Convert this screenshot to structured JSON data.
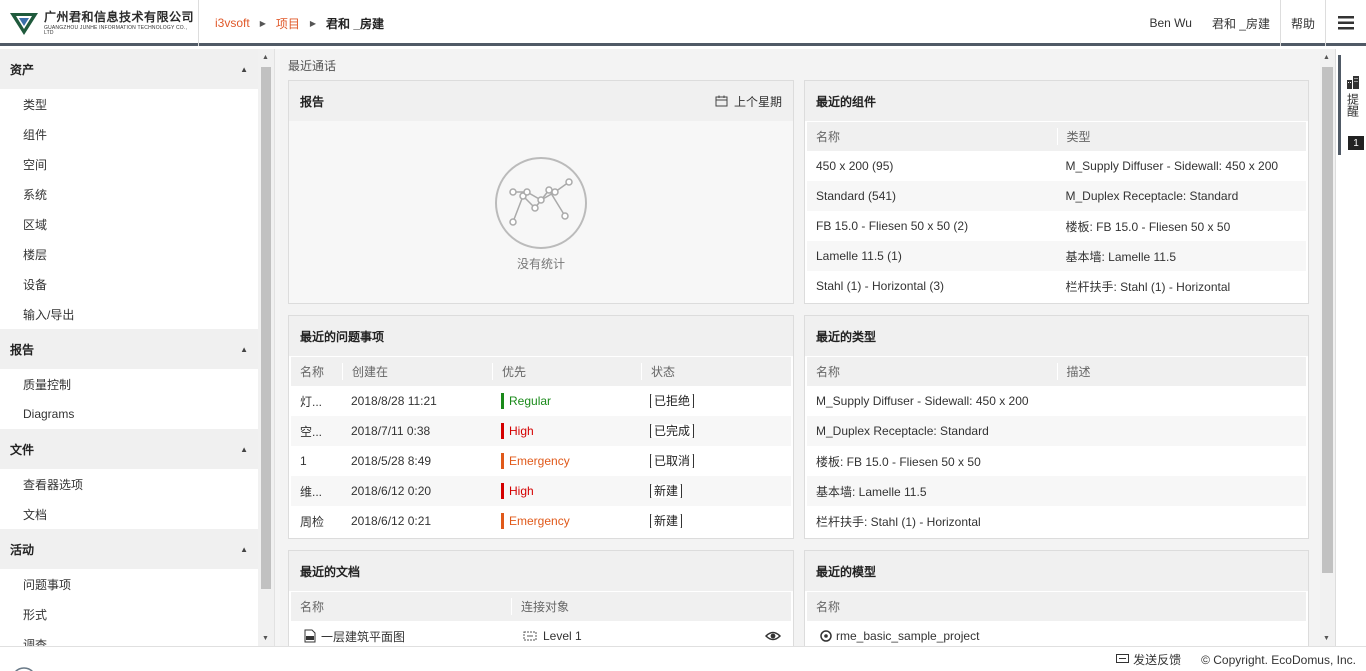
{
  "header": {
    "logo_cn": "广州君和信息技术有限公司",
    "logo_en": "GUANGZHOU JUNHE INFORMATION TECHNOLOGY CO., LTD",
    "breadcrumbs": [
      "i3vsoft",
      "项目",
      "君和 _房建"
    ],
    "user": "Ben Wu",
    "project": "君和 _房建",
    "help": "帮助"
  },
  "sidebar": {
    "sections": [
      {
        "title": "资产",
        "items": [
          "类型",
          "组件",
          "空间",
          "系统",
          "区域",
          "楼层",
          "设备",
          "输入/导出"
        ]
      },
      {
        "title": "报告",
        "items": [
          "质量控制",
          "Diagrams"
        ]
      },
      {
        "title": "文件",
        "items": [
          "查看器选项",
          "文档"
        ]
      },
      {
        "title": "活动",
        "items": [
          "问题事项",
          "形式",
          "调查"
        ]
      }
    ]
  },
  "main": {
    "title": "最近通话",
    "report": {
      "title": "报告",
      "period": "上个星期",
      "empty": "没有统计"
    },
    "components": {
      "title": "最近的组件",
      "headers": [
        "名称",
        "类型"
      ],
      "rows": [
        [
          "450 x 200 (95)",
          "M_Supply Diffuser - Sidewall: 450 x 200"
        ],
        [
          "Standard (541)",
          "M_Duplex Receptacle: Standard"
        ],
        [
          "FB 15.0 - Fliesen 50 x 50 (2)",
          "楼板: FB 15.0 - Fliesen 50 x 50"
        ],
        [
          "Lamelle 11.5 (1)",
          "基本墙: Lamelle 11.5"
        ],
        [
          "Stahl (1) - Horizontal (3)",
          "栏杆扶手: Stahl (1) - Horizontal"
        ]
      ]
    },
    "issues": {
      "title": "最近的问题事项",
      "headers": [
        "名称",
        "创建在",
        "优先",
        "状态"
      ],
      "rows": [
        {
          "name": "灯...",
          "date": "2018/8/28 11:21",
          "priority": "Regular",
          "color": "#1a8a1a",
          "status": "已拒绝"
        },
        {
          "name": "空...",
          "date": "2018/7/11 0:38",
          "priority": "High",
          "color": "#d40000",
          "status": "已完成"
        },
        {
          "name": "1",
          "date": "2018/5/28 8:49",
          "priority": "Emergency",
          "color": "#e0591a",
          "status": "已取消"
        },
        {
          "name": "维...",
          "date": "2018/6/12 0:20",
          "priority": "High",
          "color": "#d40000",
          "status": "新建"
        },
        {
          "name": "周检",
          "date": "2018/6/12 0:21",
          "priority": "Emergency",
          "color": "#e0591a",
          "status": "新建"
        }
      ]
    },
    "types": {
      "title": "最近的类型",
      "headers": [
        "名称",
        "描述"
      ],
      "rows": [
        [
          "M_Supply Diffuser - Sidewall: 450 x 200",
          ""
        ],
        [
          "M_Duplex Receptacle: Standard",
          ""
        ],
        [
          "楼板: FB 15.0 - Fliesen 50 x 50",
          ""
        ],
        [
          "基本墙: Lamelle 11.5",
          ""
        ],
        [
          "栏杆扶手: Stahl (1) - Horizontal",
          ""
        ]
      ]
    },
    "documents": {
      "title": "最近的文档",
      "headers": [
        "名称",
        "连接对象",
        ""
      ],
      "rows": [
        {
          "name": "一层建筑平面图",
          "link": "Level 1"
        }
      ]
    },
    "models": {
      "title": "最近的模型",
      "headers": [
        "名称"
      ],
      "rows": [
        "rme_basic_sample_project"
      ]
    }
  },
  "right_strip": {
    "label": "提醒",
    "badge": "1"
  },
  "footer": {
    "feedback": "发送反馈",
    "copyright": "© Copyright. EcoDomus, Inc."
  }
}
